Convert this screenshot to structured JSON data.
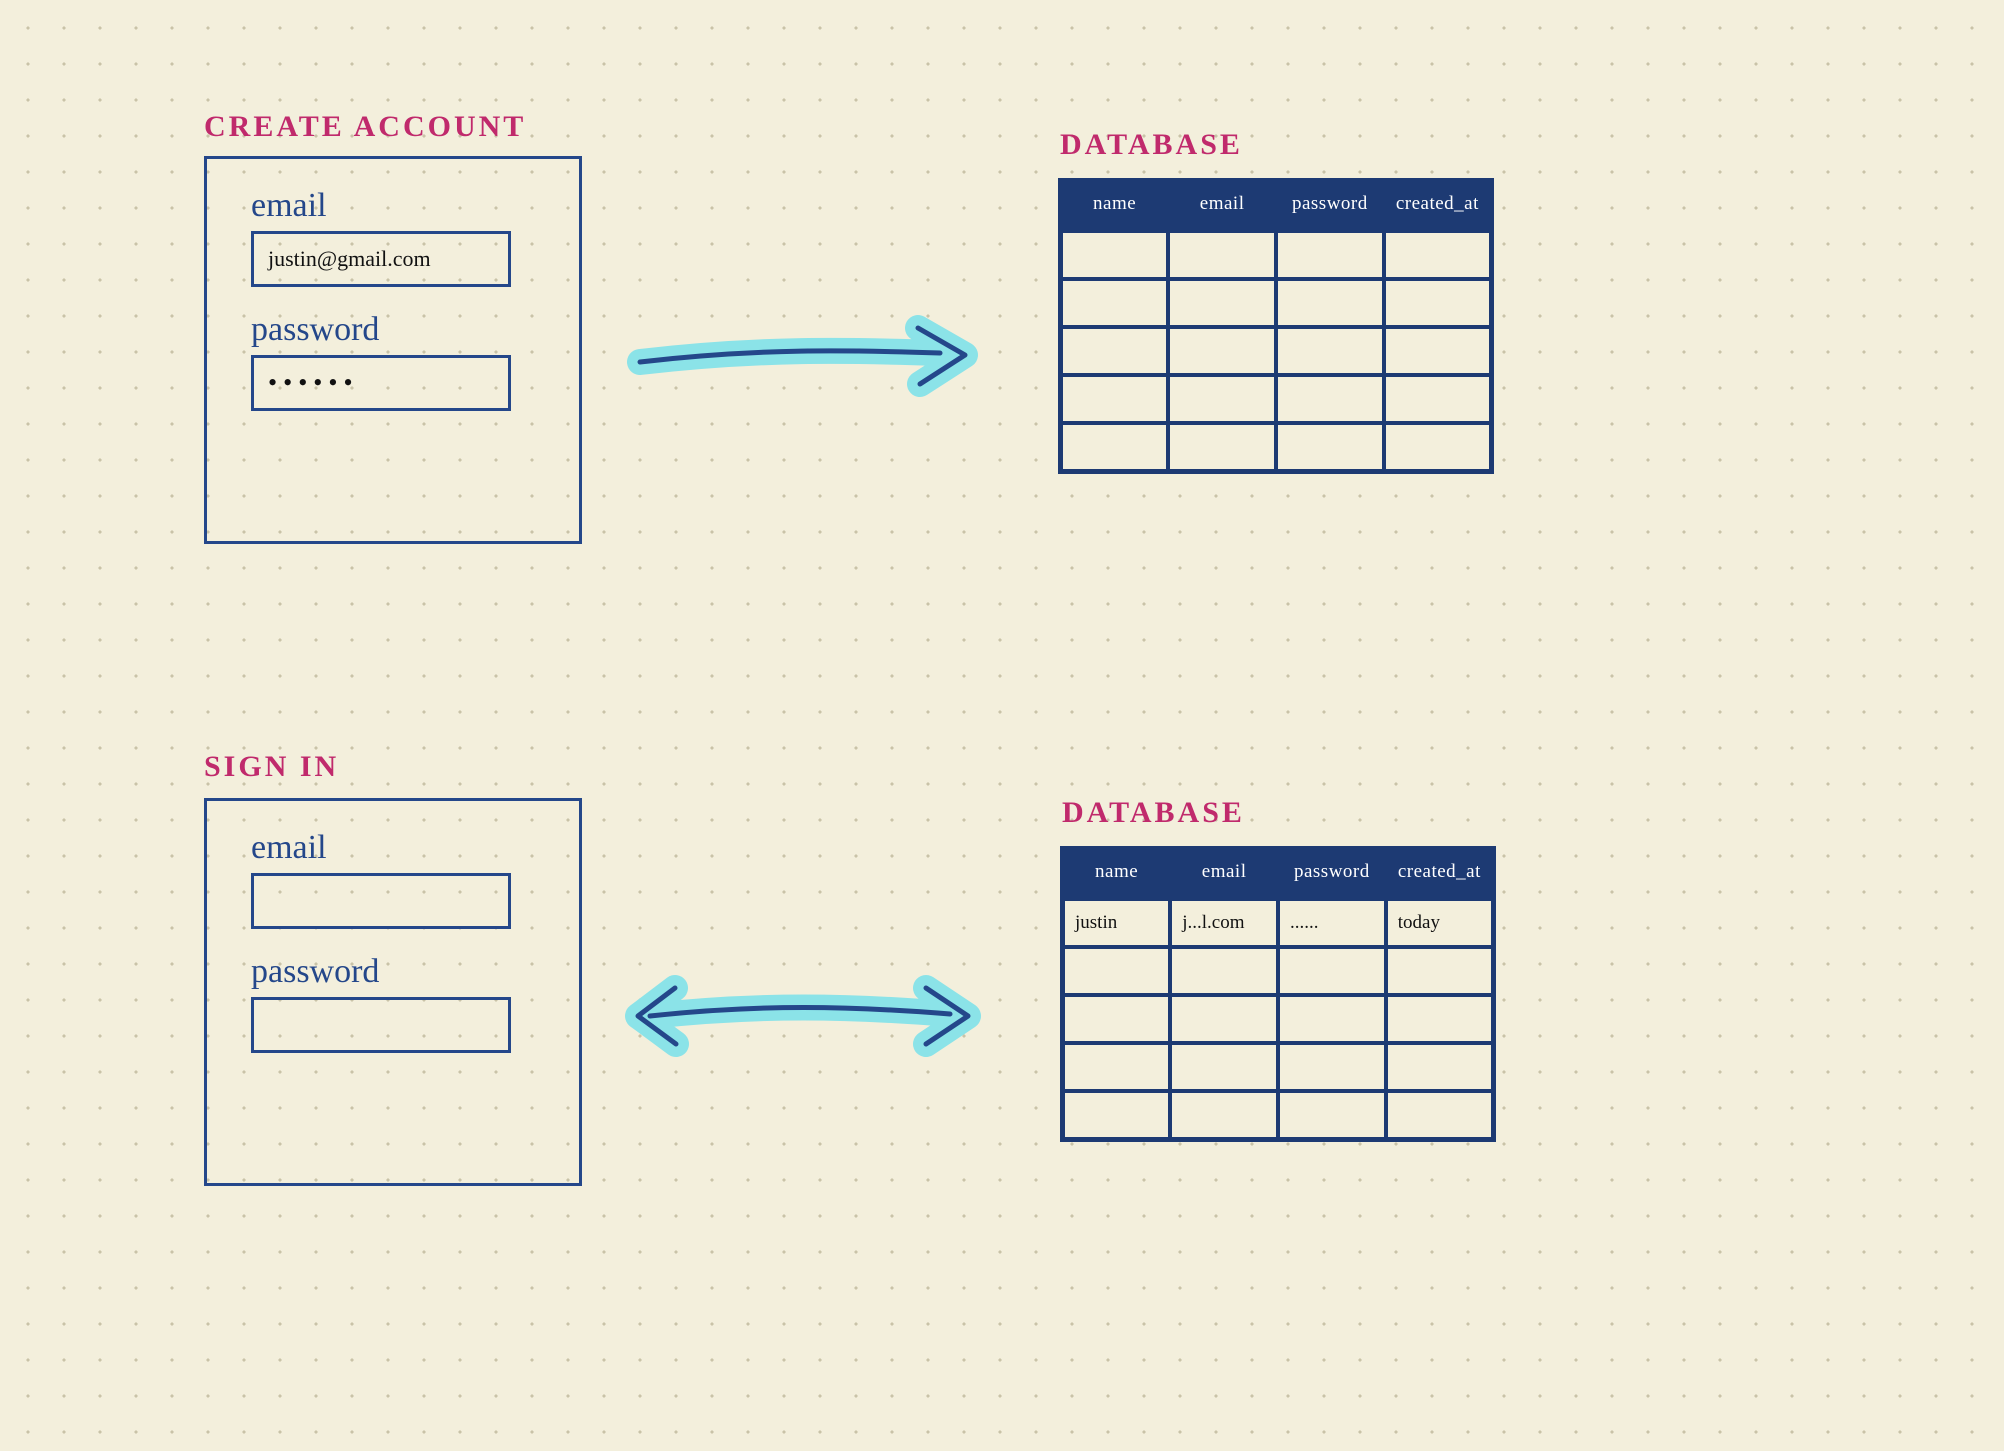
{
  "colors": {
    "ink": "#24478a",
    "paper": "#f3efdc",
    "accent_pink": "#c02a6c",
    "highlight": "#8be3e8"
  },
  "create_account": {
    "title": "CREATE  ACCOUNT",
    "email_label": "email",
    "email_value": "justin@gmail.com",
    "password_label": "password",
    "password_value": "••••••"
  },
  "sign_in": {
    "title": "SIGN IN",
    "email_label": "email",
    "email_value": "",
    "password_label": "password",
    "password_value": ""
  },
  "database1": {
    "title": "DATABASE",
    "columns": [
      "name",
      "email",
      "password",
      "created_at"
    ],
    "rows": [
      [
        "",
        "",
        "",
        ""
      ],
      [
        "",
        "",
        "",
        ""
      ],
      [
        "",
        "",
        "",
        ""
      ],
      [
        "",
        "",
        "",
        ""
      ],
      [
        "",
        "",
        "",
        ""
      ]
    ]
  },
  "database2": {
    "title": "DATABASE",
    "columns": [
      "name",
      "email",
      "password",
      "created_at"
    ],
    "rows": [
      [
        "justin",
        "j...l.com",
        "......",
        "today"
      ],
      [
        "",
        "",
        "",
        ""
      ],
      [
        "",
        "",
        "",
        ""
      ],
      [
        "",
        "",
        "",
        ""
      ],
      [
        "",
        "",
        "",
        ""
      ]
    ]
  },
  "arrows": {
    "top": "right",
    "bottom": "both"
  }
}
